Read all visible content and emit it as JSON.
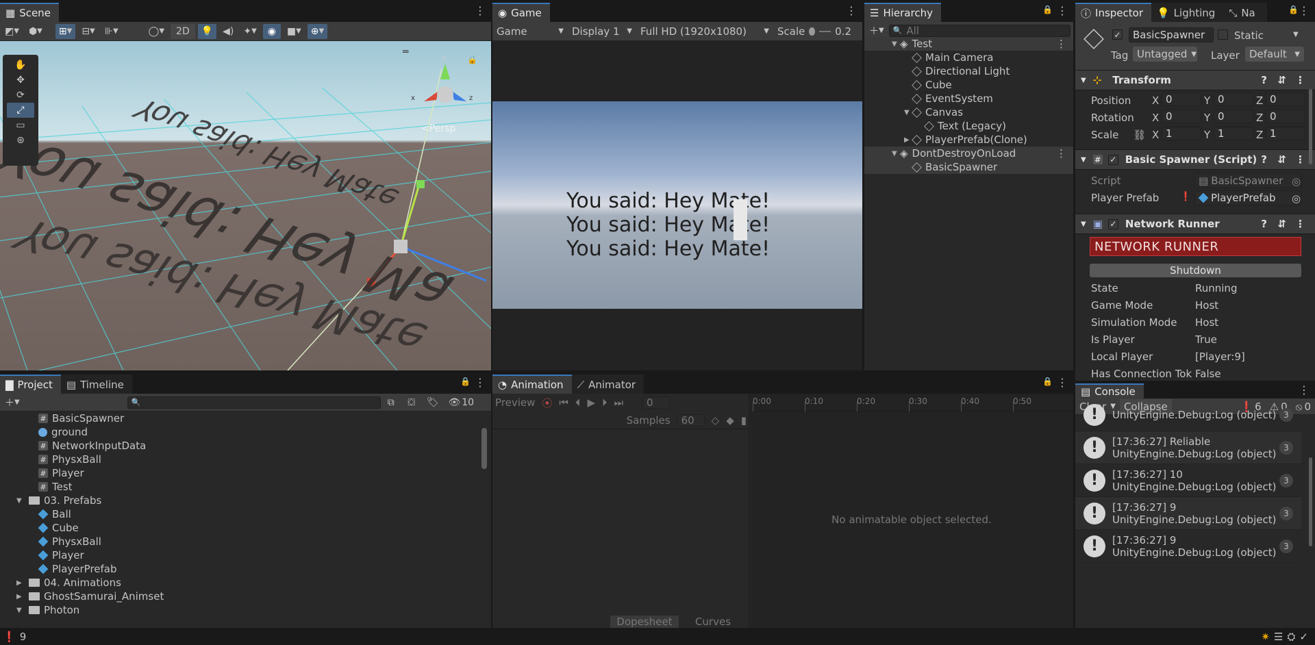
{
  "scene": {
    "tab": "Scene",
    "btn_2d": "2D",
    "persp": "<Persp",
    "axis_x": "x",
    "axis_y": "y",
    "axis_z": "z",
    "world_text": [
      "You said: Hey Ma",
      "You said: Hey Mate",
      "You said: Hey Mate"
    ]
  },
  "game": {
    "tab": "Game",
    "display_mode": "Game",
    "display": "Display 1",
    "resolution": "Full HD (1920x1080)",
    "scale_label": "Scale",
    "scale_value": "0.2",
    "lines": [
      "You said: Hey Mate!",
      "You said: Hey Mate!",
      "You said: Hey Mate!"
    ]
  },
  "hierarchy": {
    "tab": "Hierarchy",
    "search_placeholder": "All",
    "items": [
      {
        "label": "Test",
        "depth": 0,
        "kind": "scene"
      },
      {
        "label": "Main Camera",
        "depth": 1,
        "kind": "object"
      },
      {
        "label": "Directional Light",
        "depth": 1,
        "kind": "object"
      },
      {
        "label": "Cube",
        "depth": 1,
        "kind": "object"
      },
      {
        "label": "EventSystem",
        "depth": 1,
        "kind": "object"
      },
      {
        "label": "Canvas",
        "depth": 1,
        "kind": "object"
      },
      {
        "label": "Text (Legacy)",
        "depth": 2,
        "kind": "object"
      },
      {
        "label": "PlayerPrefab(Clone)",
        "depth": 1,
        "kind": "object"
      },
      {
        "label": "DontDestroyOnLoad",
        "depth": 0,
        "kind": "scene"
      },
      {
        "label": "BasicSpawner",
        "depth": 1,
        "kind": "object"
      }
    ]
  },
  "inspector": {
    "tabs": [
      "Inspector",
      "Lighting",
      "Na "
    ],
    "object_name": "BasicSpawner",
    "static_label": "Static",
    "tag_label": "Tag",
    "tag_value": "Untagged",
    "layer_label": "Layer",
    "layer_value": "Default",
    "transform_title": "Transform",
    "position_label": "Position",
    "rotation_label": "Rotation",
    "scale_label": "Scale",
    "position": [
      "0",
      "0",
      "0"
    ],
    "rotation": [
      "0",
      "0",
      "0"
    ],
    "scale": [
      "1",
      "1",
      "1"
    ],
    "axis_x": "X",
    "axis_y": "Y",
    "axis_z": "Z",
    "spawner_title": "Basic Spawner (Script)",
    "script_label": "Script",
    "script_value": "BasicSpawner",
    "player_prefab_label": "Player Prefab",
    "player_prefab_value": "PlayerPrefab",
    "runner_title": "Network Runner",
    "runner_banner": "NETWORK RUNNER",
    "shutdown": "Shutdown",
    "props": [
      {
        "label": "State",
        "value": "Running"
      },
      {
        "label": "Game Mode",
        "value": "Host"
      },
      {
        "label": "Simulation Mode",
        "value": "Host"
      },
      {
        "label": "Is Player",
        "value": "True"
      },
      {
        "label": "Local Player",
        "value": "[Player:9]"
      },
      {
        "label": "Has Connection Tok",
        "value": "False"
      }
    ]
  },
  "project": {
    "tabs": [
      "Project",
      "Timeline"
    ],
    "hidden_count": "10",
    "items": [
      {
        "label": "BasicSpawner",
        "kind": "script",
        "indent": 2
      },
      {
        "label": "ground",
        "kind": "material",
        "indent": 2
      },
      {
        "label": "NetworkInputData",
        "kind": "script",
        "indent": 2
      },
      {
        "label": "PhysxBall",
        "kind": "script",
        "indent": 2
      },
      {
        "label": "Player",
        "kind": "script",
        "indent": 2
      },
      {
        "label": "Test",
        "kind": "script",
        "indent": 2
      },
      {
        "label": "03. Prefabs",
        "kind": "folder-open",
        "indent": 1
      },
      {
        "label": "Ball",
        "kind": "prefab",
        "indent": 2
      },
      {
        "label": "Cube",
        "kind": "prefab",
        "indent": 2
      },
      {
        "label": "PhysxBall",
        "kind": "prefab",
        "indent": 2
      },
      {
        "label": "Player",
        "kind": "prefab",
        "indent": 2
      },
      {
        "label": "PlayerPrefab",
        "kind": "prefab",
        "indent": 2
      },
      {
        "label": "04. Animations",
        "kind": "folder",
        "indent": 1
      },
      {
        "label": "GhostSamurai_Animset",
        "kind": "folder",
        "indent": 1
      },
      {
        "label": "Photon",
        "kind": "folder-open",
        "indent": 1
      }
    ]
  },
  "animation": {
    "tabs": [
      "Animation",
      "Animator"
    ],
    "preview": "Preview",
    "frame": "0",
    "samples_label": "Samples",
    "samples_value": "60",
    "ticks": [
      "0:00",
      "0:10",
      "0:20",
      "0:30",
      "0:40",
      "0:50"
    ],
    "empty": "No animatable object selected.",
    "dopesheet": "Dopesheet",
    "curves": "Curves"
  },
  "console": {
    "tab": "Console",
    "clear": "Clear",
    "collapse": "Collapse",
    "log_count": "6",
    "warn_count": "0",
    "err_count": "0",
    "entries": [
      {
        "line1": "",
        "line2": "UnityEngine.Debug:Log (object)",
        "count": "3"
      },
      {
        "line1": "[17:36:27] Reliable",
        "line2": "UnityEngine.Debug:Log (object)",
        "count": "3"
      },
      {
        "line1": "[17:36:27] 10",
        "line2": "UnityEngine.Debug:Log (object)",
        "count": "3"
      },
      {
        "line1": "[17:36:27] 9",
        "line2": "UnityEngine.Debug:Log (object)",
        "count": "3"
      },
      {
        "line1": "[17:36:27] 9",
        "line2": "UnityEngine.Debug:Log (object)",
        "count": "3"
      }
    ]
  },
  "status": {
    "message": "9"
  }
}
